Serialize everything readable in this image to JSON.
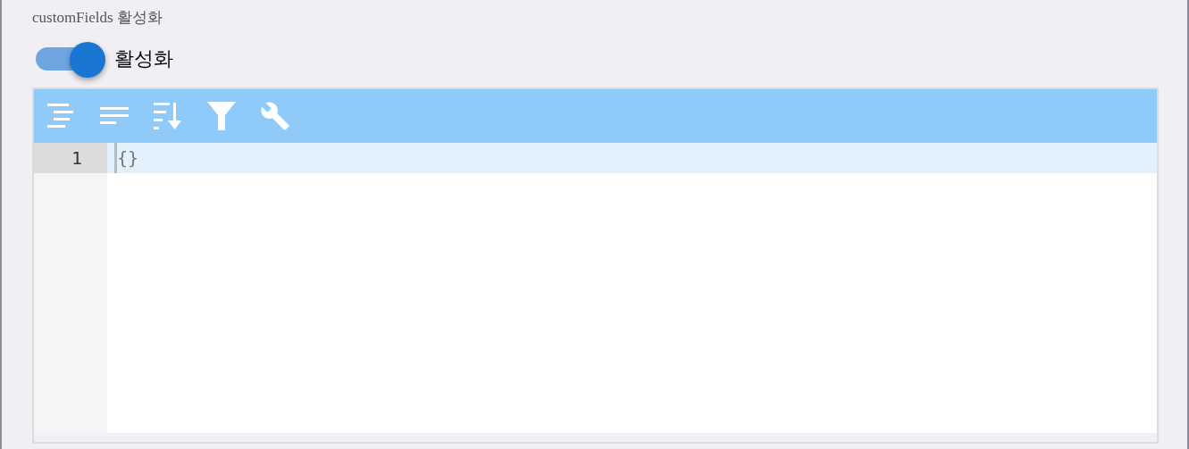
{
  "field_label": "customFields 활성화",
  "toggle": {
    "on": true,
    "label": "활성화"
  },
  "editor": {
    "lines": [
      {
        "number": "1",
        "text": "{}",
        "active": true
      }
    ]
  }
}
